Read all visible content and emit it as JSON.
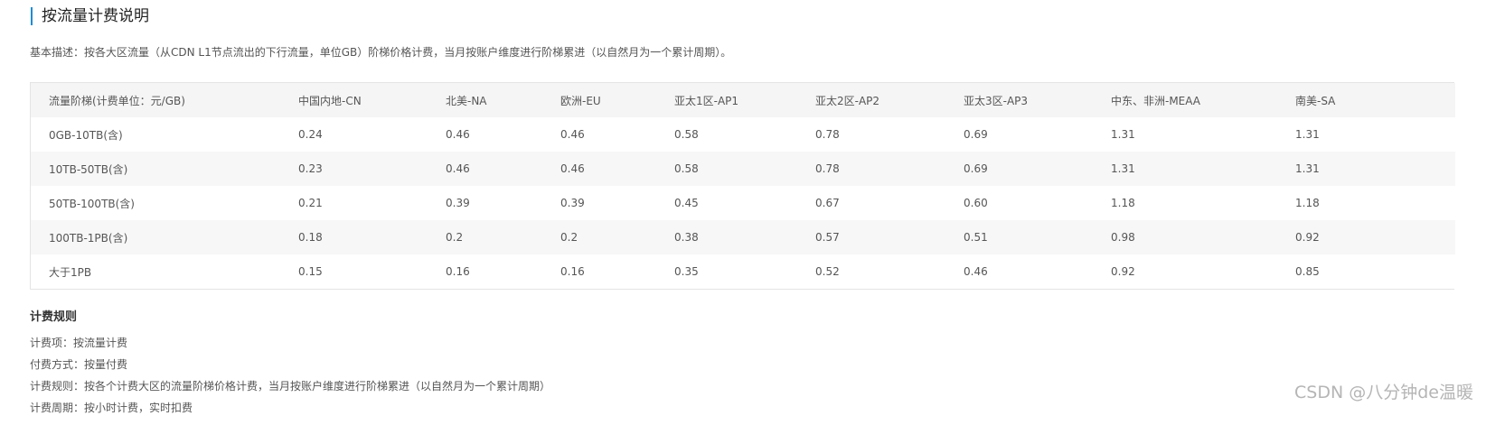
{
  "title": "按流量计费说明",
  "description": "基本描述：按各大区流量（从CDN L1节点流出的下行流量，单位GB）阶梯价格计费，当月按账户维度进行阶梯累进（以自然月为一个累计周期）。",
  "table": {
    "headers": [
      "流量阶梯(计费单位：元/GB)",
      "中国内地-CN",
      "北美-NA",
      "欧洲-EU",
      "亚太1区-AP1",
      "亚太2区-AP2",
      "亚太3区-AP3",
      "中东、非洲-MEAA",
      "南美-SA"
    ],
    "rows": [
      [
        "0GB-10TB(含)",
        "0.24",
        "0.46",
        "0.46",
        "0.58",
        "0.78",
        "0.69",
        "1.31",
        "1.31"
      ],
      [
        "10TB-50TB(含)",
        "0.23",
        "0.46",
        "0.46",
        "0.58",
        "0.78",
        "0.69",
        "1.31",
        "1.31"
      ],
      [
        "50TB-100TB(含)",
        "0.21",
        "0.39",
        "0.39",
        "0.45",
        "0.67",
        "0.60",
        "1.18",
        "1.18"
      ],
      [
        "100TB-1PB(含)",
        "0.18",
        "0.2",
        "0.2",
        "0.38",
        "0.57",
        "0.51",
        "0.98",
        "0.92"
      ],
      [
        "大于1PB",
        "0.15",
        "0.16",
        "0.16",
        "0.35",
        "0.52",
        "0.46",
        "0.92",
        "0.85"
      ]
    ]
  },
  "rules": {
    "title": "计费规则",
    "items": [
      "计费项：按流量计费",
      "付费方式：按量付费",
      "计费规则：按各个计费大区的流量阶梯价格计费，当月按账户维度进行阶梯累进（以自然月为一个累计周期）",
      "计费周期：按小时计费，实时扣费"
    ]
  },
  "watermark": "CSDN @八分钟de温暖",
  "colors": {
    "accent": "#1e8cd8",
    "header_bg": "#f5f5f5",
    "stripe_bg": "#f7f7f7",
    "border": "#e4e4e4"
  }
}
